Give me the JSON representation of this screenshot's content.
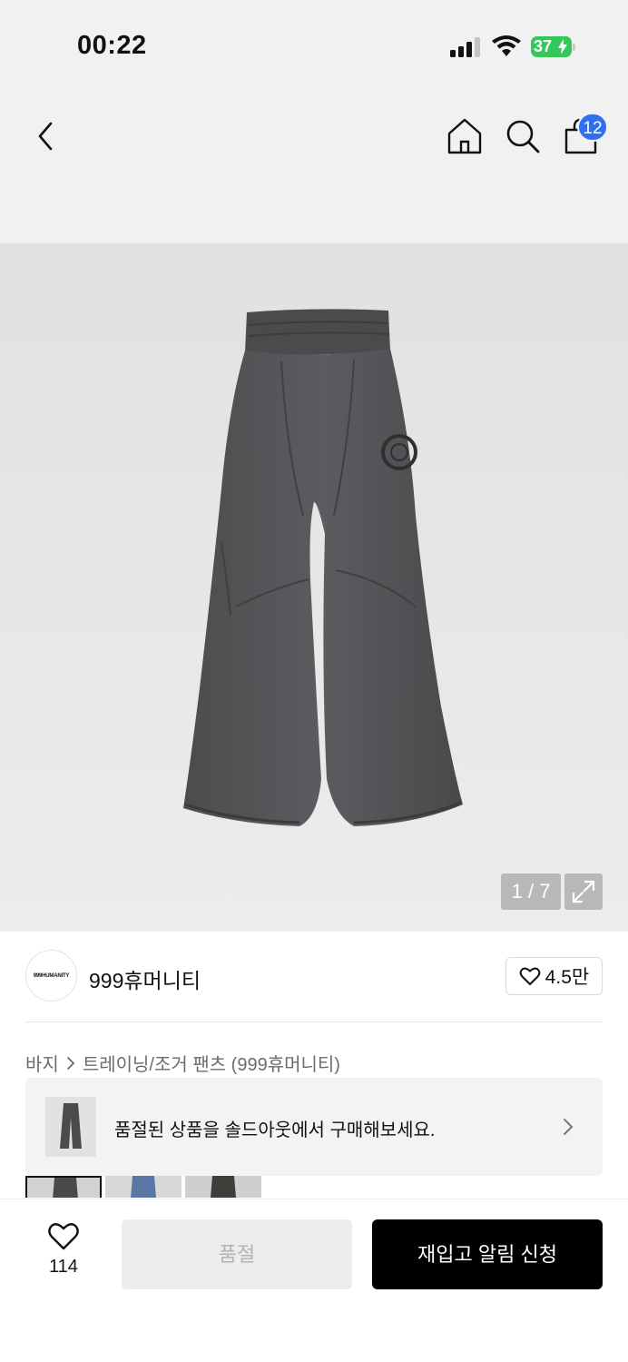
{
  "status_bar": {
    "time": "00:22",
    "battery_level": "37",
    "icons": [
      "signal-icon",
      "wifi-icon",
      "battery-charging-icon"
    ]
  },
  "nav": {
    "icons": [
      "back-chevron-icon",
      "home-icon",
      "search-icon",
      "shopping-bag-icon"
    ],
    "cart_count": "12"
  },
  "gallery": {
    "current": "1",
    "separator": "/",
    "total": "7",
    "expand_icon": "expand-icon"
  },
  "brand": {
    "logo_text": "999HUMANITY",
    "name": "999휴머니티",
    "likes": "4.5만",
    "like_icon": "heart-outline-icon"
  },
  "breadcrumb": {
    "category": "바지",
    "separator_icon": "chevron-right-icon",
    "subcategory": "트레이닝/조거 팬츠 (999휴머니티)"
  },
  "soldout_banner": {
    "text": "품절된 상품을 솔드아웃에서 구매해보세요.",
    "chevron_icon": "chevron-right-icon"
  },
  "color_options": {
    "colors": [
      "#4a4a4a",
      "#5a78a6",
      "#3d3f3a"
    ],
    "selected_index": 0
  },
  "bottom_bar": {
    "wish_count": "114",
    "wish_icon": "heart-outline-icon",
    "soldout_label": "품절",
    "restock_label": "재입고 알림 신청"
  },
  "colors": {
    "badge": "#2f6ff3",
    "battery": "#34c759",
    "primary_button": "#000000",
    "disabled_button": "#ececec"
  }
}
